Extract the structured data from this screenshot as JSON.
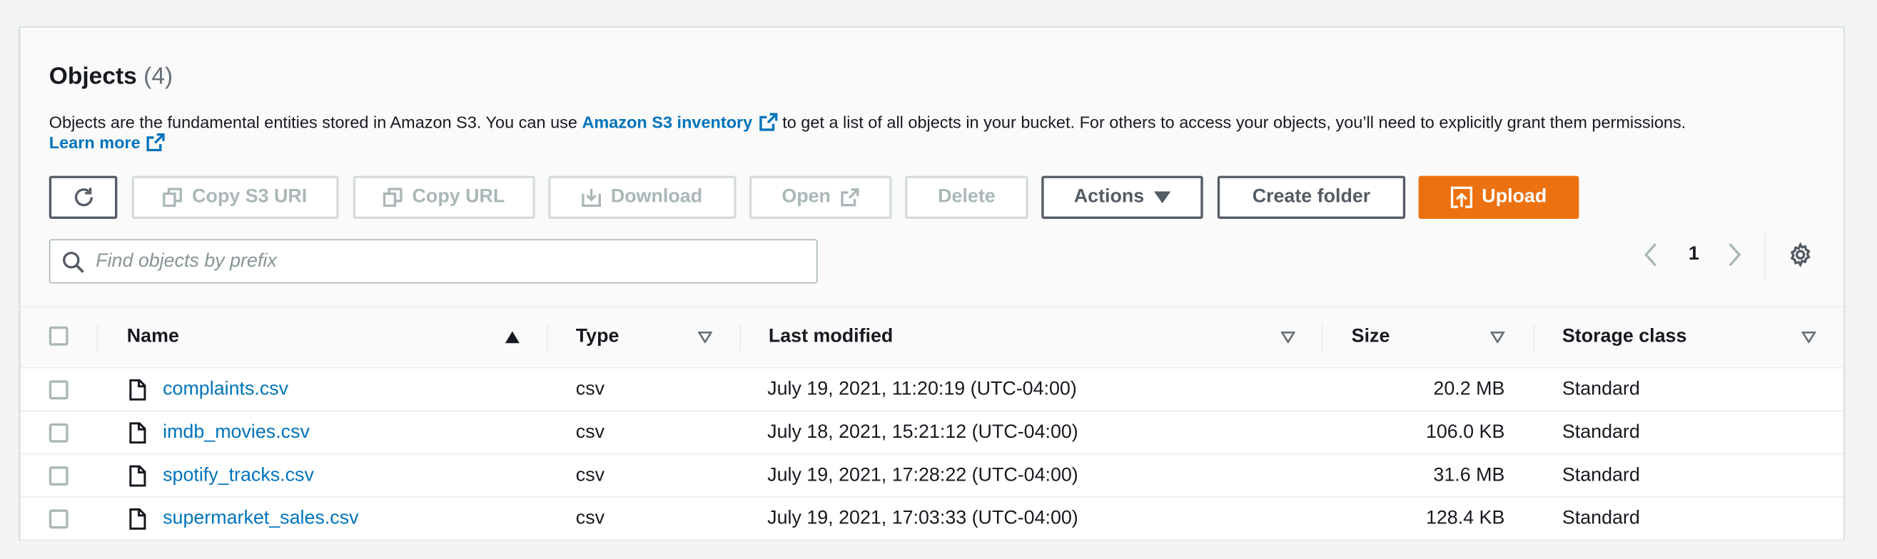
{
  "objects": {
    "title": "Objects",
    "count": "(4)",
    "description_before": "Objects are the fundamental entities stored in Amazon S3. You can use",
    "inventory_link": "Amazon S3 inventory",
    "description_after": "to get a list of all objects in your bucket. For others to access your objects, you’ll need to explicitly grant them permissions.",
    "learn_more": "Learn more"
  },
  "toolbar": {
    "copy_s3_uri": "Copy S3 URI",
    "copy_url": "Copy URL",
    "download": "Download",
    "open": "Open",
    "delete": "Delete",
    "actions": "Actions",
    "create_folder": "Create folder",
    "upload": "Upload"
  },
  "search": {
    "placeholder": "Find objects by prefix",
    "value": ""
  },
  "pagination": {
    "current_page": "1"
  },
  "table": {
    "columns": {
      "name": "Name",
      "type": "Type",
      "last_modified": "Last modified",
      "size": "Size",
      "storage_class": "Storage class"
    },
    "rows": [
      {
        "name": "complaints.csv",
        "type": "csv",
        "last_modified": "July 19, 2021, 11:20:19 (UTC-04:00)",
        "size": "20.2 MB",
        "storage_class": "Standard"
      },
      {
        "name": "imdb_movies.csv",
        "type": "csv",
        "last_modified": "July 18, 2021, 15:21:12 (UTC-04:00)",
        "size": "106.0 KB",
        "storage_class": "Standard"
      },
      {
        "name": "spotify_tracks.csv",
        "type": "csv",
        "last_modified": "July 19, 2021, 17:28:22 (UTC-04:00)",
        "size": "31.6 MB",
        "storage_class": "Standard"
      },
      {
        "name": "supermarket_sales.csv",
        "type": "csv",
        "last_modified": "July 19, 2021, 17:03:33 (UTC-04:00)",
        "size": "128.4 KB",
        "storage_class": "Standard"
      }
    ]
  },
  "colors": {
    "link": "#0073bb",
    "primary": "#ec7211",
    "disabled": "#aab7b8",
    "text": "#16191f"
  }
}
